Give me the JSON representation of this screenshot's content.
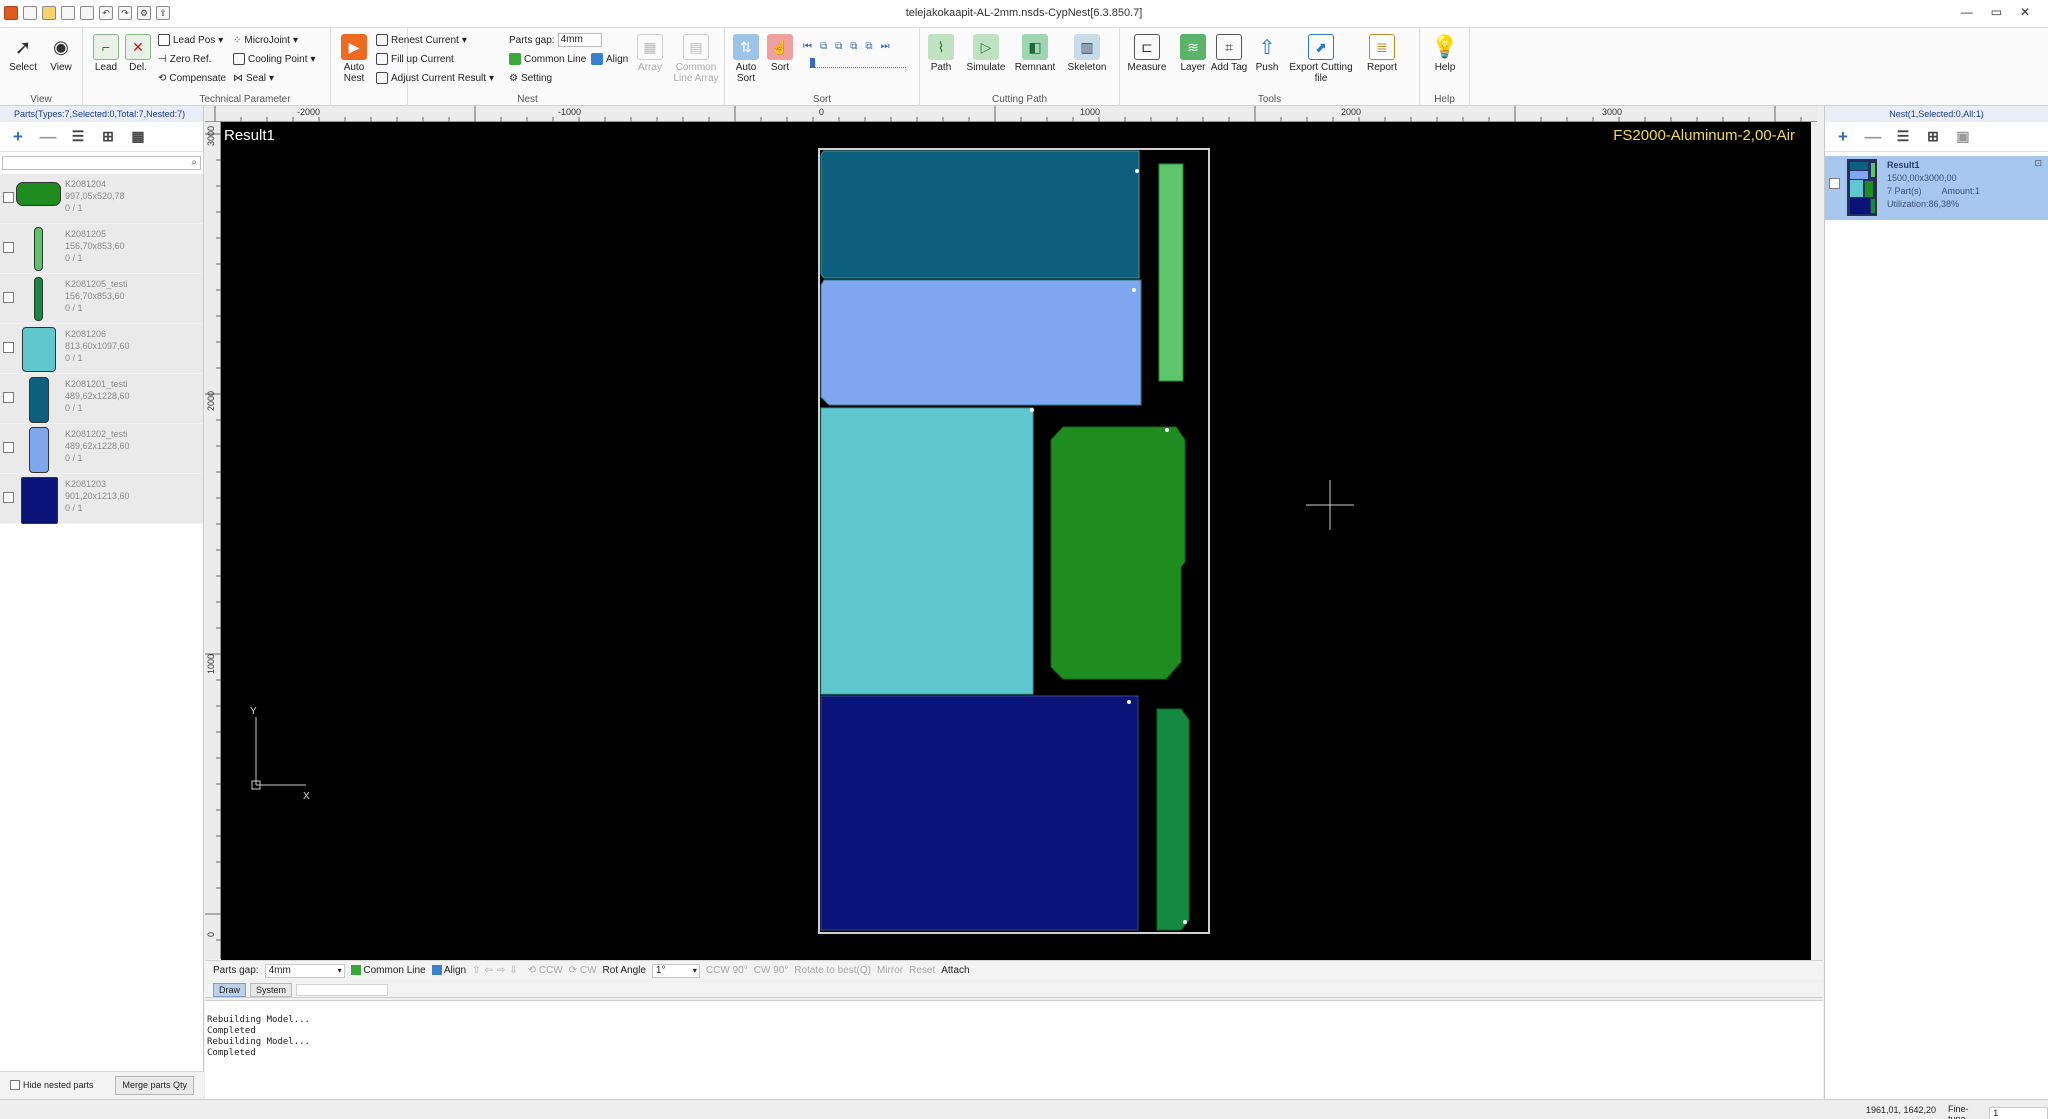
{
  "window": {
    "title": "telejakokaapit-AL-2mm.nsds-CypNest[6.3.850.7]",
    "controls": [
      "—",
      "▭",
      "✕"
    ]
  },
  "ribbon": {
    "view_group": {
      "label": "View",
      "select": "Select",
      "view": "View"
    },
    "tech_group": {
      "label": "Technical Parameter",
      "lead": "Lead",
      "del": "Del.",
      "lead_pos": "Lead Pos",
      "zero_ref": "Zero Ref.",
      "compensate": "Compensate",
      "microjoint": "MicroJoint",
      "cooling_point": "Cooling Point",
      "seal": "Seal"
    },
    "nest_group": {
      "label": "Nest",
      "auto_nest": "Auto Nest",
      "renest_current": "Renest Current",
      "fill_up_current": "Fill up Current",
      "adjust_current_result": "Adjust Current Result",
      "parts_gap_label": "Parts gap:",
      "parts_gap_value": "4mm",
      "common_line": "Common Line",
      "align": "Align",
      "setting": "Setting",
      "array": "Array",
      "common_line_array": "Common Line Array"
    },
    "sort_group": {
      "label": "Sort",
      "auto_sort": "Auto Sort",
      "sort": "Sort"
    },
    "cutting_group": {
      "label": "Cutting Path",
      "path": "Path",
      "simulate": "Simulate",
      "remnant": "Remnant",
      "skeleton": "Skeleton"
    },
    "tools_group": {
      "label": "Tools",
      "measure": "Measure",
      "layer": "Layer",
      "add_tag": "Add Tag",
      "push": "Push",
      "export_cutting_file": "Export Cutting file",
      "report": "Report"
    },
    "help_group": {
      "label": "Help",
      "help": "Help"
    }
  },
  "left_panel": {
    "header": "Parts(Types:7,Selected:0,Total:7,Nested:7)",
    "parts": [
      {
        "name": "K2081204",
        "size": "997,05x520,78",
        "count": "0 / 1",
        "color": "#1e8c1e"
      },
      {
        "name": "K2081205",
        "size": "156,70x853,60",
        "count": "0 / 1",
        "color": "#5cc46a"
      },
      {
        "name": "K2081205_testi",
        "size": "156,70x853,60",
        "count": "0 / 1",
        "color": "#138a40"
      },
      {
        "name": "K2081206",
        "size": "813,60x1097,60",
        "count": "0 / 1",
        "color": "#5ec8ce"
      },
      {
        "name": "K2081201_testi",
        "size": "489,62x1228,60",
        "count": "0 / 1",
        "color": "#0d5f7e"
      },
      {
        "name": "K2081202_testi",
        "size": "489,62x1228,60",
        "count": "0 / 1",
        "color": "#7fa7f0"
      },
      {
        "name": "K2081203",
        "size": "901,20x1213,60",
        "count": "0 / 1",
        "color": "#0a1478"
      }
    ],
    "hide_nested": "Hide nested parts",
    "merge_parts": "Merge parts Qty"
  },
  "right_panel": {
    "header": "Nest(1,Selected:0,All:1)",
    "result": {
      "name": "Result1",
      "size": "1500,00x3000,00",
      "parts": "7 Part(s)",
      "amount": "Amount:1",
      "utilization": "Utilization:86,38%"
    }
  },
  "canvas": {
    "result_label": "Result1",
    "material_label": "FS2000-Aluminum-2,00-Air",
    "h_ticks": [
      "-2000",
      "-1000",
      "0",
      "1000",
      "2000",
      "3000"
    ],
    "v_ticks": [
      "3000",
      "2000",
      "1000",
      "0"
    ],
    "axis_y": "Y",
    "axis_x": "X",
    "colors": {
      "sheet_border": "#cfcfcf",
      "teal_dark": "#0d5f7e",
      "light_blue": "#7fa7f0",
      "cyan": "#5ec8ce",
      "dark_blue": "#0a1478",
      "green": "#1e8c1e",
      "light_green": "#5cc46a",
      "mid_green": "#138a40",
      "material_text": "#f5de3a"
    }
  },
  "bottom_toolbar": {
    "parts_gap_label": "Parts gap:",
    "parts_gap_value": "4mm",
    "common_line": "Common Line",
    "align": "Align",
    "ccw": "CCW",
    "cw": "CW",
    "rot_angle_label": "Rot Angle",
    "rot_angle_value": "1°",
    "ccw90": "CCW 90°",
    "cw90": "CW 90°",
    "rotate_best": "Rotate to best(Q)",
    "mirror": "Mirror",
    "reset": "Reset",
    "attach": "Attach"
  },
  "command": {
    "tab_draw": "Draw",
    "tab_system": "System",
    "log": [
      "Rebuilding Model...",
      "Completed",
      "Rebuilding Model...",
      "Completed"
    ]
  },
  "status": {
    "coords": "1961,01, 1642,20",
    "fine_tune_label": "Fine-tune",
    "fine_tune_value": "1"
  }
}
